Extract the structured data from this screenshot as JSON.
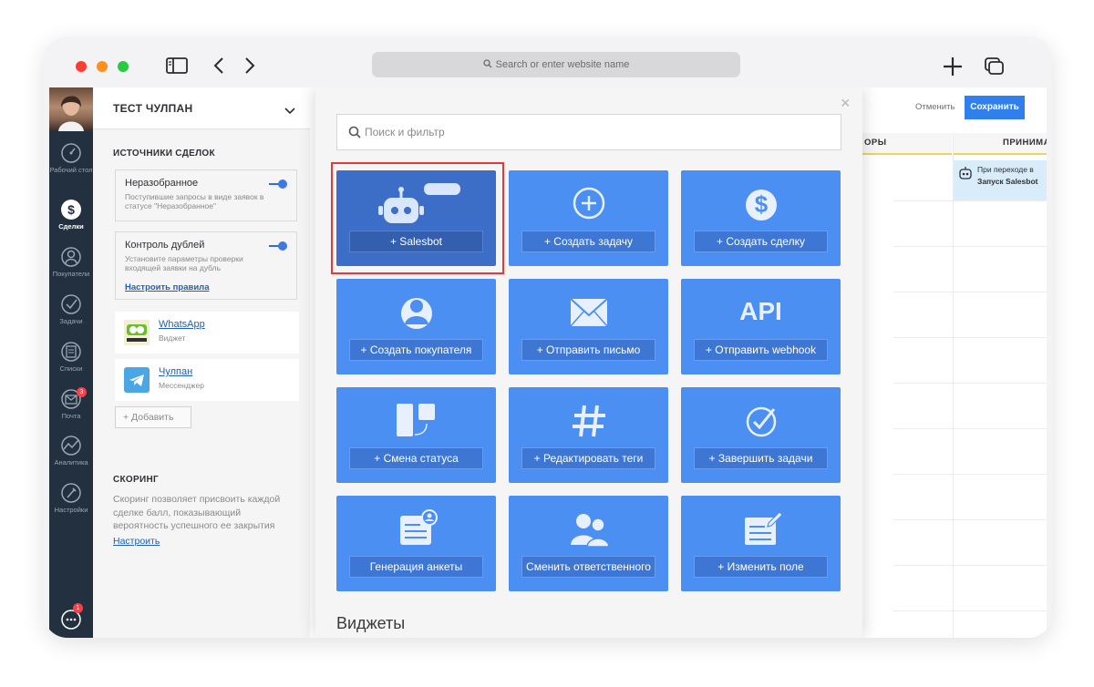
{
  "browser": {
    "url_placeholder": "Search or enter website name"
  },
  "nav": {
    "items": [
      {
        "label": "Рабочий стол",
        "icon": "dashboard-icon"
      },
      {
        "label": "Сделки",
        "icon": "deals-icon"
      },
      {
        "label": "Покупатели",
        "icon": "customers-icon"
      },
      {
        "label": "Задачи",
        "icon": "tasks-icon"
      },
      {
        "label": "Списки",
        "icon": "lists-icon"
      },
      {
        "label": "Почта",
        "icon": "mail-icon",
        "badge": "3"
      },
      {
        "label": "Аналитика",
        "icon": "analytics-icon"
      },
      {
        "label": "Настройки",
        "icon": "settings-icon"
      }
    ],
    "chat_badge": "1"
  },
  "panel": {
    "title": "ТЕСТ ЧУЛПАН",
    "sources_title": "ИСТОЧНИКИ СДЕЛОК",
    "sources": [
      {
        "name": "Неразобранное",
        "desc": "Поступившие запросы в виде заявок в статусе \"Неразобранное\""
      },
      {
        "name": "Контроль дублей",
        "desc": "Установите параметры проверки входящей заявки на дубль",
        "link": "Настроить правила"
      }
    ],
    "channels": [
      {
        "name": "WhatsApp",
        "sub": "Виджет"
      },
      {
        "name": "Чулпан",
        "sub": "Мессенджер"
      }
    ],
    "add_label": "+ Добавить",
    "scoring_title": "СКОРИНГ",
    "scoring_desc": "Скоринг позволяет присвоить каждой сделке балл, показывающий вероятность успешного ее закрытия",
    "scoring_link": "Настроить"
  },
  "board": {
    "cancel": "Отменить",
    "save": "Сохранить",
    "columns": [
      "ОРЫ",
      "ПРИНИМА"
    ],
    "trigger_line1": "При переходе в",
    "trigger_line2": "Запуск Salesbot"
  },
  "popup": {
    "search_placeholder": "Поиск и фильтр",
    "actions": [
      {
        "label": "+  Salesbot",
        "icon": "salesbot-icon",
        "selected": true
      },
      {
        "label": "+  Создать задачу",
        "icon": "add-task-icon"
      },
      {
        "label": "+  Создать сделку",
        "icon": "dollar-icon"
      },
      {
        "label": "+  Создать покупателя",
        "icon": "customer-icon"
      },
      {
        "label": "+  Отправить письмо",
        "icon": "envelope-icon"
      },
      {
        "label": "+  Отправить webhook",
        "icon": "api-icon",
        "icon_text": "API"
      },
      {
        "label": "+  Смена статуса",
        "icon": "status-change-icon"
      },
      {
        "label": "+  Редактировать теги",
        "icon": "hashtag-icon"
      },
      {
        "label": "+  Завершить задачи",
        "icon": "complete-tasks-icon"
      },
      {
        "label": "Генерация анкеты",
        "icon": "form-icon"
      },
      {
        "label": "Сменить ответственного",
        "icon": "change-responsible-icon"
      },
      {
        "label": "+  Изменить поле",
        "icon": "edit-field-icon"
      }
    ],
    "widgets_title": "Виджеты"
  },
  "colors": {
    "tile": "#4c8ff3",
    "tile_selected": "#3d6ec7",
    "highlight": "#e53935",
    "nav_bg": "#22303f",
    "save": "#2f80ed"
  }
}
